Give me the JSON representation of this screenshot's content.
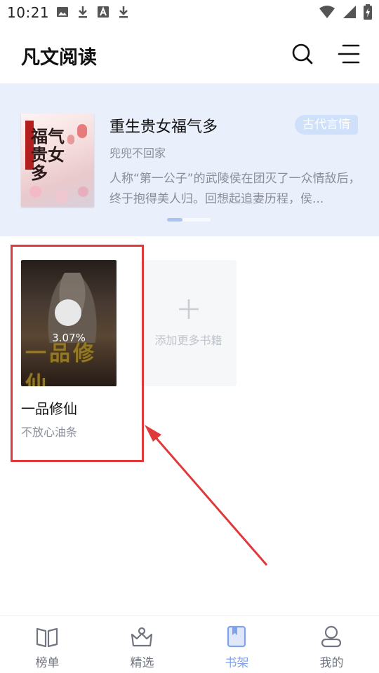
{
  "status_bar": {
    "time": "10:21",
    "left_icons": [
      "image-icon",
      "download-icon",
      "font-icon",
      "download-icon"
    ],
    "right_icons": [
      "wifi-icon",
      "signal-icon",
      "battery-charging-icon"
    ]
  },
  "header": {
    "title": "凡文阅读",
    "icons": [
      "search-icon",
      "menu-icon"
    ]
  },
  "featured": {
    "title": "重生贵女福气多",
    "tag": "古代言情",
    "author": "兜兜不回家",
    "description": "人称“第一公子”的武陵侯在团灭了一众情敌后，终于抱得美人归。回想起追妻历程，侯...",
    "cover_text": "福气贵女多",
    "carousel": {
      "count": 2,
      "active_index": 0
    }
  },
  "shelf": {
    "books": [
      {
        "title": "一品修仙",
        "author": "不放心油条",
        "progress": "3.07%",
        "cover_text": "一品修仙"
      }
    ],
    "add_more_label": "添加更多书籍"
  },
  "bottom_nav": {
    "items": [
      {
        "label": "榜单",
        "icon": "book-open-icon",
        "active": false
      },
      {
        "label": "精选",
        "icon": "crown-icon",
        "active": false
      },
      {
        "label": "书架",
        "icon": "bookshelf-icon",
        "active": true
      },
      {
        "label": "我的",
        "icon": "user-icon",
        "active": false
      }
    ]
  },
  "colors": {
    "accent": "#7fa3ea",
    "banner_bg": "#eaf0fb",
    "tag_bg": "#cfe0fb",
    "annotation": "#e0393c"
  }
}
